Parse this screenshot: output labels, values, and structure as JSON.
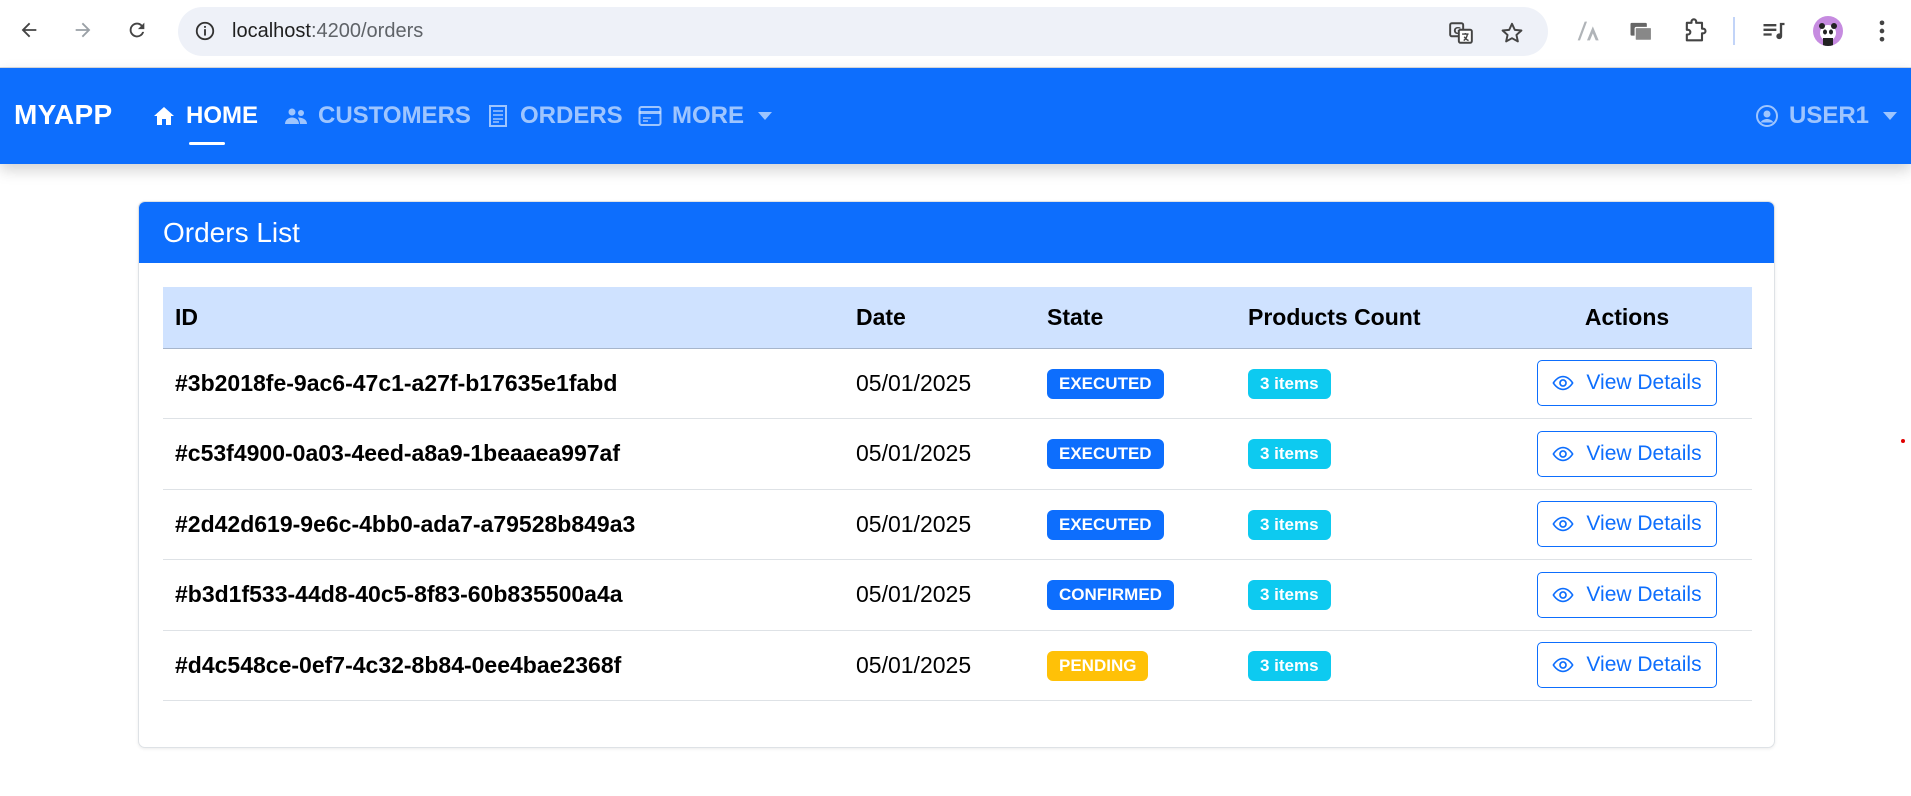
{
  "browser": {
    "url_host": "localhost",
    "url_path": ":4200/orders"
  },
  "navbar": {
    "brand": "MYAPP",
    "items": [
      {
        "label": "HOME",
        "icon": "home-icon",
        "active": true
      },
      {
        "label": "CUSTOMERS",
        "icon": "users-icon",
        "active": false
      },
      {
        "label": "ORDERS",
        "icon": "receipt-icon",
        "active": false
      },
      {
        "label": "MORE",
        "icon": "card-icon",
        "active": false
      }
    ],
    "user": {
      "label": "USER1",
      "icon": "user-circle-icon"
    }
  },
  "card": {
    "title": "Orders List"
  },
  "table": {
    "headers": {
      "id": "ID",
      "date": "Date",
      "state": "State",
      "products": "Products Count",
      "actions": "Actions"
    },
    "rows": [
      {
        "id": "#3b2018fe-9ac6-47c1-a27f-b17635e1fabd",
        "date": "05/01/2025",
        "state": "EXECUTED",
        "state_color": "#0d6efd",
        "products": "3 items",
        "action": "View Details"
      },
      {
        "id": "#c53f4900-0a03-4eed-a8a9-1beaaea997af",
        "date": "05/01/2025",
        "state": "EXECUTED",
        "state_color": "#0d6efd",
        "products": "3 items",
        "action": "View Details"
      },
      {
        "id": "#2d42d619-9e6c-4bb0-ada7-a79528b849a3",
        "date": "05/01/2025",
        "state": "EXECUTED",
        "state_color": "#0d6efd",
        "products": "3 items",
        "action": "View Details"
      },
      {
        "id": "#b3d1f533-44d8-40c5-8f83-60b835500a4a",
        "date": "05/01/2025",
        "state": "CONFIRMED",
        "state_color": "#0d6efd",
        "products": "3 items",
        "action": "View Details"
      },
      {
        "id": "#d4c548ce-0ef7-4c32-8b84-0ee4bae2368f",
        "date": "05/01/2025",
        "state": "PENDING",
        "state_color": "#ffc107",
        "products": "3 items",
        "action": "View Details"
      }
    ]
  },
  "colors": {
    "primary": "#0d6efd",
    "info": "#0dcaf0",
    "warning": "#ffc107",
    "table_header_bg": "#cfe2ff"
  }
}
